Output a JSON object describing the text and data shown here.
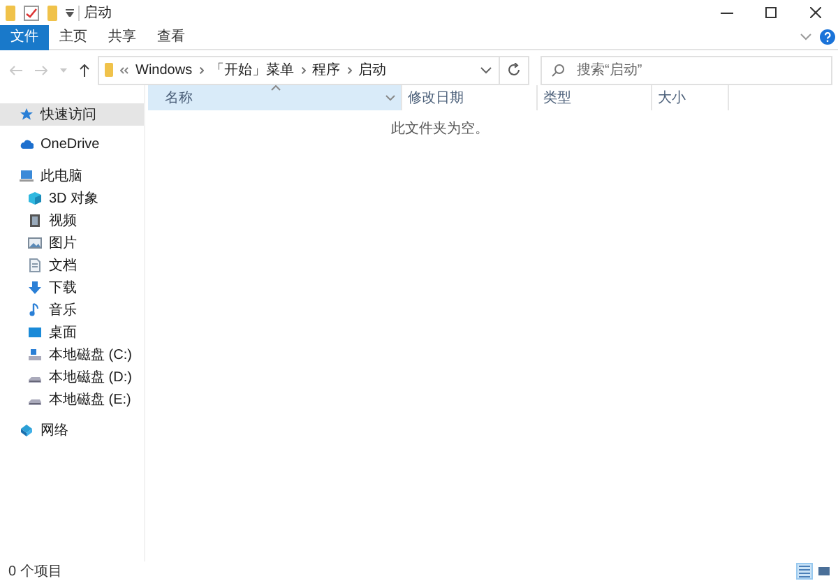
{
  "title_bar": {
    "title": "启动"
  },
  "ribbon_tabs": [
    {
      "label": "文件",
      "selected": true,
      "kind": "file"
    },
    {
      "label": "主页",
      "selected": false,
      "kind": "tab"
    },
    {
      "label": "共享",
      "selected": false,
      "kind": "tab"
    },
    {
      "label": "查看",
      "selected": false,
      "kind": "tab"
    }
  ],
  "address_bar": {
    "segments": [
      "Windows",
      "「开始」菜单",
      "程序",
      "启动"
    ]
  },
  "search": {
    "placeholder": "搜索“启动”"
  },
  "sidebar": {
    "items": [
      {
        "label": "快速访问",
        "kind": "star",
        "selected": true
      },
      {
        "label": "OneDrive",
        "kind": "cloud",
        "selected": false
      },
      {
        "label": "此电脑",
        "kind": "pc",
        "selected": false,
        "children": [
          {
            "label": "3D 对象",
            "kind": "cube",
            "selected": false
          },
          {
            "label": "视频",
            "kind": "film",
            "selected": false
          },
          {
            "label": "图片",
            "kind": "image",
            "selected": false
          },
          {
            "label": "文档",
            "kind": "doc",
            "selected": false
          },
          {
            "label": "下载",
            "kind": "download",
            "selected": false
          },
          {
            "label": "音乐",
            "kind": "music",
            "selected": false
          },
          {
            "label": "桌面",
            "kind": "desktop",
            "selected": false
          },
          {
            "label": "本地磁盘 (C:)",
            "kind": "system_drive",
            "selected": false
          },
          {
            "label": "本地磁盘 (D:)",
            "kind": "drive",
            "selected": false
          },
          {
            "label": "本地磁盘 (E:)",
            "kind": "drive",
            "selected": false
          }
        ]
      },
      {
        "label": "网络",
        "kind": "network",
        "selected": false
      }
    ]
  },
  "columns": [
    {
      "label": "名称",
      "sorted": true
    },
    {
      "label": "修改日期",
      "sorted": false
    },
    {
      "label": "类型",
      "sorted": false
    },
    {
      "label": "大小",
      "sorted": false
    }
  ],
  "empty_message": "此文件夹为空。",
  "status_bar": {
    "item_count": "0 个项目",
    "views": [
      {
        "kind": "details",
        "selected": true
      },
      {
        "kind": "large_icons",
        "selected": false
      }
    ]
  }
}
